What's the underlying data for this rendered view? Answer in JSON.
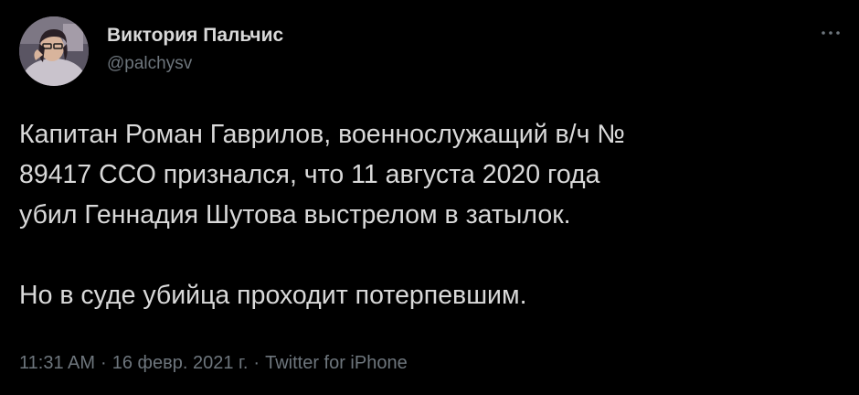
{
  "tweet": {
    "author": {
      "display_name": "Виктория Пальчис",
      "handle": "@palchysv",
      "avatar_icon": "profile-photo"
    },
    "more_icon": "more-horizontal-icon",
    "body": {
      "line1": "Капитан Роман Гаврилов, военнослужащий  в/ч №",
      "line2": "89417 ССО признался, что 11 августа 2020 года",
      "line3": "убил Геннадия Шутова выстрелом в затылок.",
      "paragraph2": "Но в суде убийца проходит потерпевшим."
    },
    "meta": {
      "time": "11:31 AM",
      "separator": "·",
      "date": "16 февр. 2021 г.",
      "source": "Twitter for iPhone"
    }
  },
  "colors": {
    "background": "#000000",
    "primary_text": "#d9d9d9",
    "secondary_text": "#6e767d"
  }
}
